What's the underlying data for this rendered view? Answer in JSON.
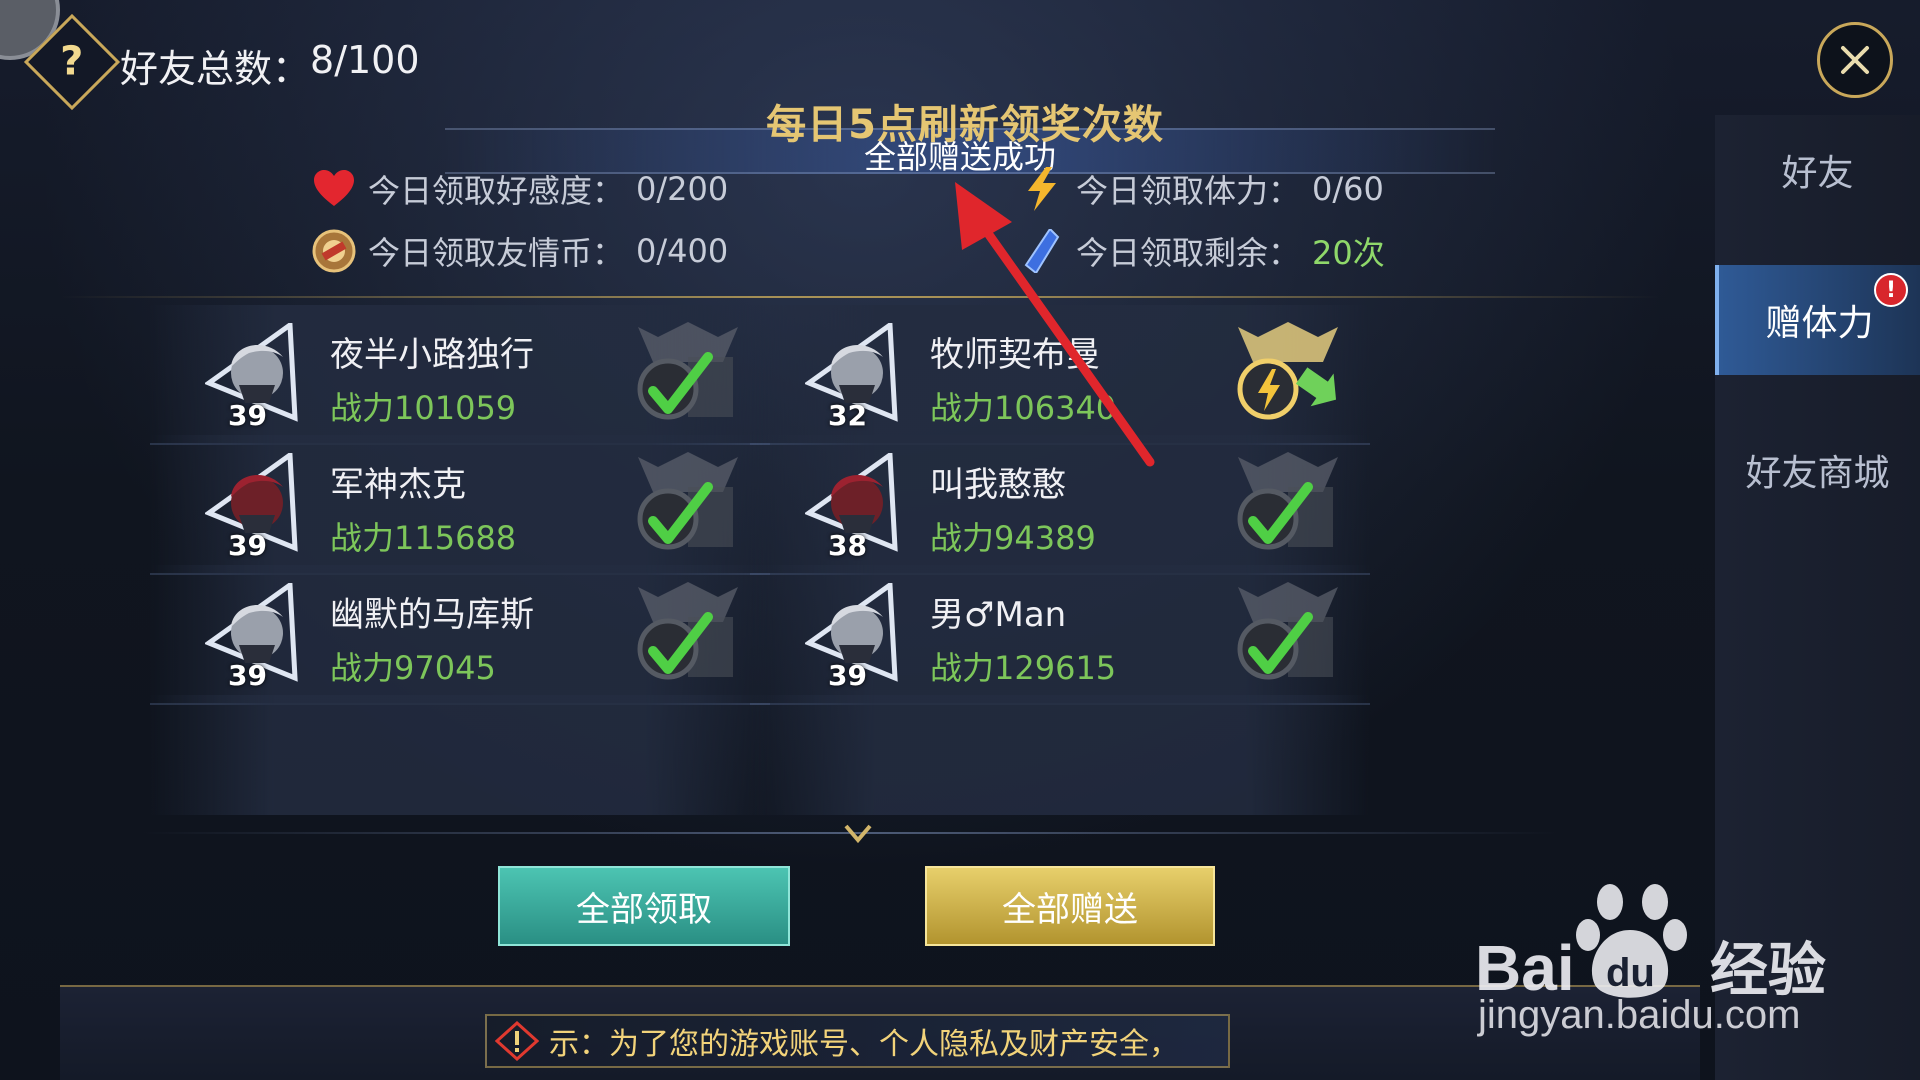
{
  "header": {
    "friend_total_label": "好友总数：",
    "friend_total_value": "8/100",
    "help_glyph": "?"
  },
  "refresh": {
    "title": "每日5点刷新领奖次数",
    "toast": "全部赠送成功"
  },
  "stats": {
    "affection_label": "今日领取好感度：",
    "affection_value": "0/200",
    "coin_label": "今日领取友情币：",
    "coin_value": "0/400",
    "stamina_label": "今日领取体力：",
    "stamina_value": "0/60",
    "remaining_label": "今日领取剩余：",
    "remaining_value": "20次"
  },
  "tabs": [
    {
      "label": "好友",
      "active": false
    },
    {
      "label": "赠体力",
      "active": true,
      "badge": "!"
    },
    {
      "label": "好友商城",
      "active": false
    }
  ],
  "friends": [
    {
      "name": "夜半小路独行",
      "power": "战力101059",
      "level": "39",
      "avatar": "silver-hair",
      "gift_state": "sent"
    },
    {
      "name": "牧师契布曼",
      "power": "战力106340",
      "level": "32",
      "avatar": "silver-hair",
      "gift_state": "claimable"
    },
    {
      "name": "军神杰克",
      "power": "战力115688",
      "level": "39",
      "avatar": "red-hair",
      "gift_state": "sent"
    },
    {
      "name": "叫我憨憨",
      "power": "战力94389",
      "level": "38",
      "avatar": "red-hair",
      "gift_state": "sent"
    },
    {
      "name": "幽默的马库斯",
      "power": "战力97045",
      "level": "39",
      "avatar": "silver-hair",
      "gift_state": "sent"
    },
    {
      "name": "男♂Man",
      "power": "战力129615",
      "level": "39",
      "avatar": "silver-hair",
      "gift_state": "sent"
    }
  ],
  "actions": {
    "claim_all": "全部领取",
    "send_all": "全部赠送"
  },
  "notice": {
    "text": "示：为了您的游戏账号、个人隐私及财产安全，"
  },
  "watermark": {
    "brand": "Baidu经验",
    "url": "jingyan.baidu.com"
  },
  "colors": {
    "gold": "#c9a85a",
    "power_green": "#7dc65a",
    "claim_teal": "#3aa99b",
    "send_gold": "#d3b84e",
    "arrow_red": "#e0262c"
  }
}
